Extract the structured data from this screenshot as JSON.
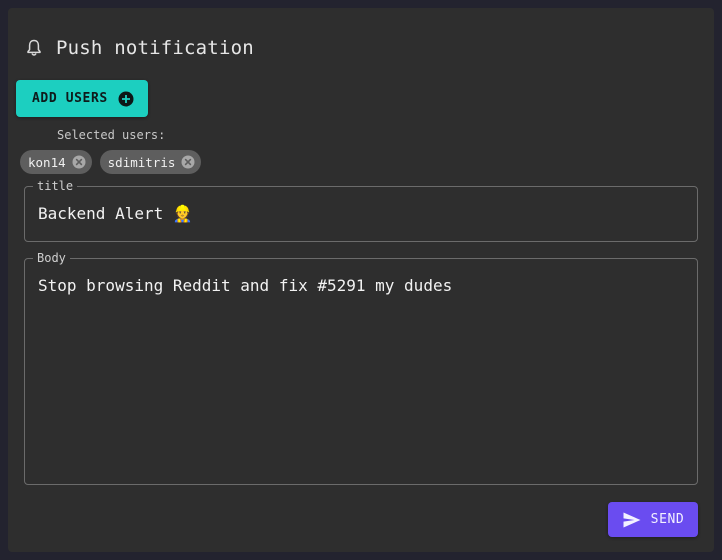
{
  "header": {
    "title": "Push notification",
    "icon": "bell-icon"
  },
  "actions": {
    "add_users_label": "ADD USERS",
    "add_icon": "plus-circle-icon",
    "send_label": "SEND",
    "send_icon": "send-icon"
  },
  "selected_users": {
    "label": "Selected users:",
    "users": [
      {
        "name": "kon14"
      },
      {
        "name": "sdimitris"
      }
    ]
  },
  "form": {
    "title_label": "title",
    "title_value": "Backend Alert 👷",
    "body_label": "Body",
    "body_value": "Stop browsing Reddit and fix #5291 my dudes"
  },
  "colors": {
    "page_background": "#23232f",
    "card_background": "#2e2e2e",
    "add_button": "#1ccfc0",
    "send_button": "#6a4cf0",
    "chip_background": "#5e5e5e"
  }
}
